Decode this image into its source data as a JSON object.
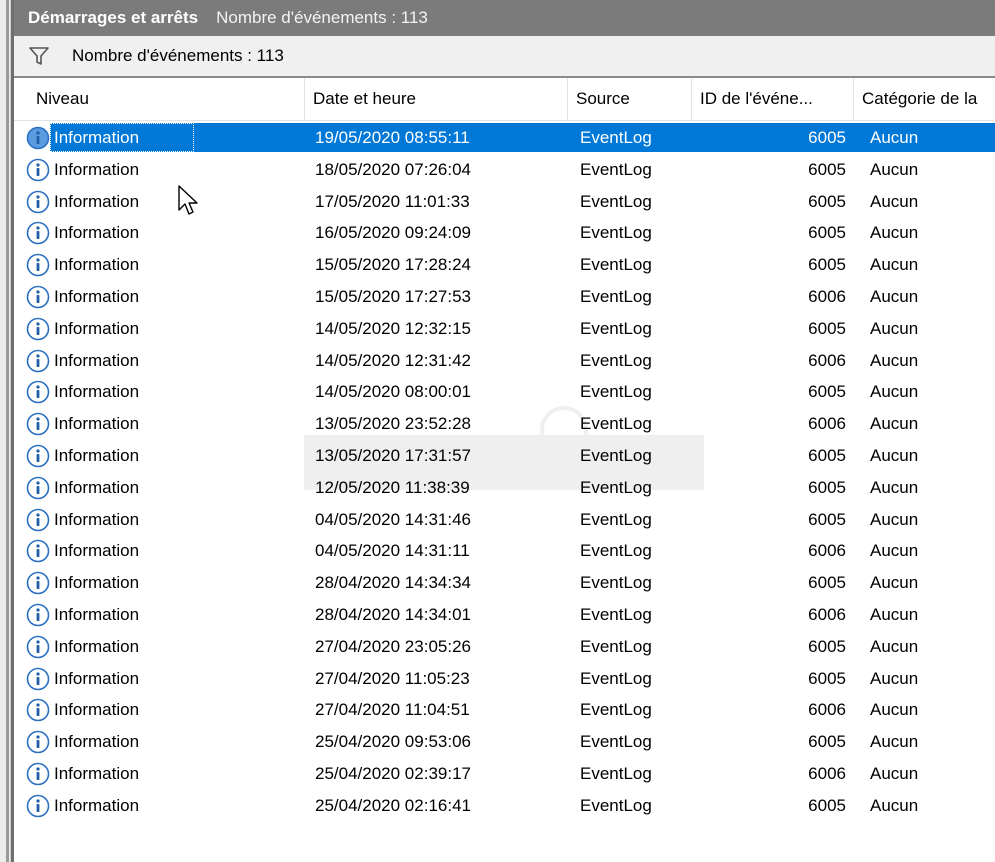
{
  "title": {
    "name": "Démarrages et arrêts",
    "count": "Nombre d'événements : 113"
  },
  "filter": {
    "label": "Nombre d'événements : 113",
    "icon": "filter-icon"
  },
  "columns": [
    "Niveau",
    "Date et heure",
    "Source",
    "ID de l'événe...",
    "Catégorie de la"
  ],
  "rows": [
    {
      "niveau": "Information",
      "date": "19/05/2020 08:55:11",
      "source": "EventLog",
      "id": "6005",
      "cat": "Aucun",
      "selected": true
    },
    {
      "niveau": "Information",
      "date": "18/05/2020 07:26:04",
      "source": "EventLog",
      "id": "6005",
      "cat": "Aucun"
    },
    {
      "niveau": "Information",
      "date": "17/05/2020 11:01:33",
      "source": "EventLog",
      "id": "6005",
      "cat": "Aucun"
    },
    {
      "niveau": "Information",
      "date": "16/05/2020 09:24:09",
      "source": "EventLog",
      "id": "6005",
      "cat": "Aucun"
    },
    {
      "niveau": "Information",
      "date": "15/05/2020 17:28:24",
      "source": "EventLog",
      "id": "6005",
      "cat": "Aucun"
    },
    {
      "niveau": "Information",
      "date": "15/05/2020 17:27:53",
      "source": "EventLog",
      "id": "6006",
      "cat": "Aucun"
    },
    {
      "niveau": "Information",
      "date": "14/05/2020 12:32:15",
      "source": "EventLog",
      "id": "6005",
      "cat": "Aucun"
    },
    {
      "niveau": "Information",
      "date": "14/05/2020 12:31:42",
      "source": "EventLog",
      "id": "6006",
      "cat": "Aucun"
    },
    {
      "niveau": "Information",
      "date": "14/05/2020 08:00:01",
      "source": "EventLog",
      "id": "6005",
      "cat": "Aucun"
    },
    {
      "niveau": "Information",
      "date": "13/05/2020 23:52:28",
      "source": "EventLog",
      "id": "6006",
      "cat": "Aucun"
    },
    {
      "niveau": "Information",
      "date": "13/05/2020 17:31:57",
      "source": "EventLog",
      "id": "6005",
      "cat": "Aucun"
    },
    {
      "niveau": "Information",
      "date": "12/05/2020 11:38:39",
      "source": "EventLog",
      "id": "6005",
      "cat": "Aucun"
    },
    {
      "niveau": "Information",
      "date": "04/05/2020 14:31:46",
      "source": "EventLog",
      "id": "6005",
      "cat": "Aucun"
    },
    {
      "niveau": "Information",
      "date": "04/05/2020 14:31:11",
      "source": "EventLog",
      "id": "6006",
      "cat": "Aucun"
    },
    {
      "niveau": "Information",
      "date": "28/04/2020 14:34:34",
      "source": "EventLog",
      "id": "6005",
      "cat": "Aucun"
    },
    {
      "niveau": "Information",
      "date": "28/04/2020 14:34:01",
      "source": "EventLog",
      "id": "6006",
      "cat": "Aucun"
    },
    {
      "niveau": "Information",
      "date": "27/04/2020 23:05:26",
      "source": "EventLog",
      "id": "6005",
      "cat": "Aucun"
    },
    {
      "niveau": "Information",
      "date": "27/04/2020 11:05:23",
      "source": "EventLog",
      "id": "6005",
      "cat": "Aucun"
    },
    {
      "niveau": "Information",
      "date": "27/04/2020 11:04:51",
      "source": "EventLog",
      "id": "6006",
      "cat": "Aucun"
    },
    {
      "niveau": "Information",
      "date": "25/04/2020 09:53:06",
      "source": "EventLog",
      "id": "6005",
      "cat": "Aucun"
    },
    {
      "niveau": "Information",
      "date": "25/04/2020 02:39:17",
      "source": "EventLog",
      "id": "6006",
      "cat": "Aucun"
    },
    {
      "niveau": "Information",
      "date": "25/04/2020 02:16:41",
      "source": "EventLog",
      "id": "6005",
      "cat": "Aucun"
    }
  ],
  "colors": {
    "selection": "#0078d7",
    "titlebar": "#7b7b7b",
    "info_icon": "#2a6fc1"
  }
}
